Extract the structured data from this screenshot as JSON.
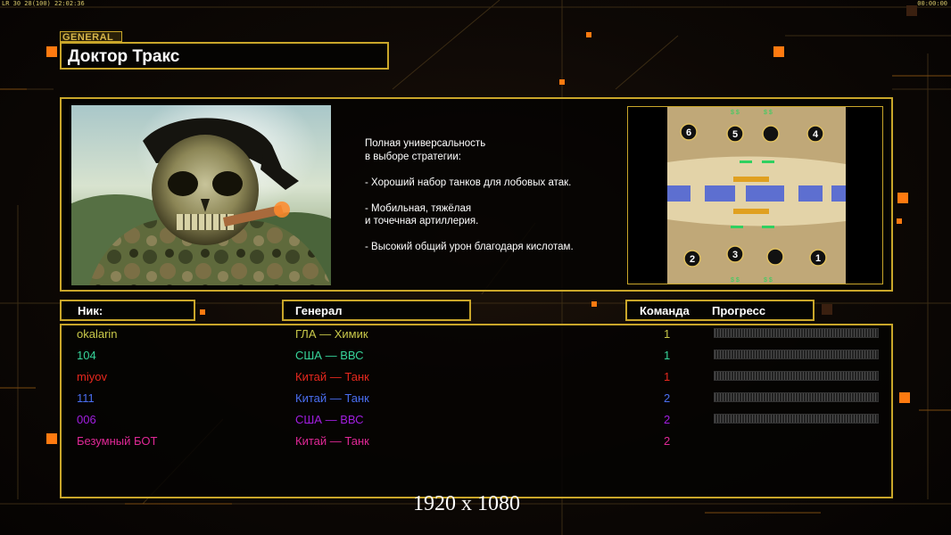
{
  "hud": {
    "top_left": "LR 30 28(100) 22:02:36",
    "top_right": "00:00:00"
  },
  "general_tag": "GENERAL",
  "general_name": "Доктор Тракс",
  "description": {
    "p1": "Полная универсальность\nв выборе стратегии:",
    "p2": "- Хороший набор танков для лобовых атак.",
    "p3": "- Мобильная, тяжёлая\nи точечная артиллерия.",
    "p4": "- Высокий общий урон благодаря кислотам."
  },
  "map": {
    "slots": [
      "6",
      "5",
      "4",
      "2",
      "3",
      "1"
    ],
    "money_symbol": "$ $"
  },
  "headers": {
    "nick": "Ник:",
    "general": "Генерал",
    "team": "Команда",
    "progress": "Прогресс"
  },
  "players": [
    {
      "nick": "okalarin",
      "general": "ГЛА — Химик",
      "team": "1",
      "color": "#c8c84a"
    },
    {
      "nick": "104",
      "general": "США — ВВС",
      "team": "1",
      "color": "#37d49a"
    },
    {
      "nick": "miyov",
      "general": "Китай — Танк",
      "team": "1",
      "color": "#e6281e"
    },
    {
      "nick": "111",
      "general": "Китай — Танк",
      "team": "2",
      "color": "#4a6ef0"
    },
    {
      "nick": "006",
      "general": "США — ВВС",
      "team": "2",
      "color": "#a21ee0"
    },
    {
      "nick": "Безумный БОТ",
      "general": "Китай — Танк",
      "team": "2",
      "color": "#e02896"
    }
  ],
  "resolution_label": "1920 x 1080",
  "colors": {
    "accent": "#c9a62a",
    "orange_square": "#ff7a10"
  }
}
